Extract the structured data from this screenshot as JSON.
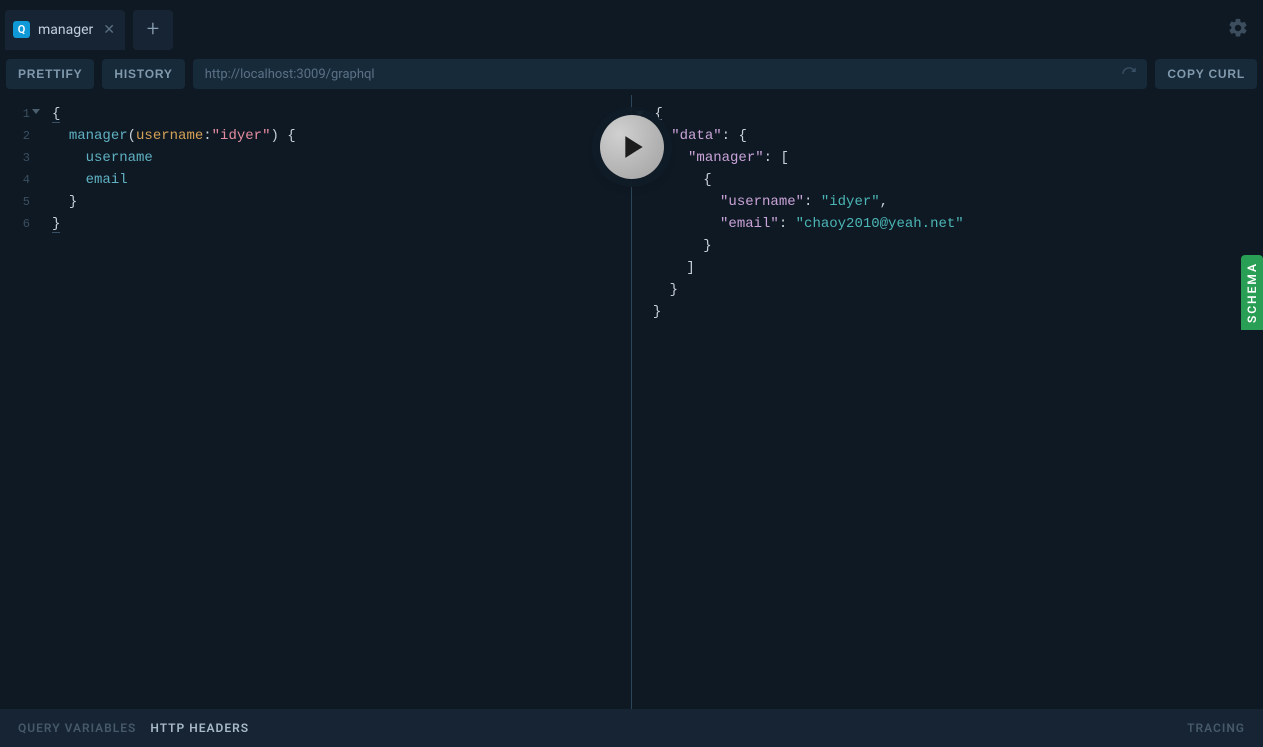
{
  "tabs": {
    "active": {
      "badge": "Q",
      "label": "manager"
    }
  },
  "toolbar": {
    "prettify": "PRETTIFY",
    "history": "HISTORY",
    "url": "http://localhost:3009/graphql",
    "copy_curl": "COPY CURL"
  },
  "editor": {
    "lines": [
      "1",
      "2",
      "3",
      "4",
      "5",
      "6"
    ],
    "tokens": {
      "q_manager": "manager",
      "q_open": "(",
      "q_arg": "username",
      "q_colon": ":",
      "q_argval": "\"idyer\"",
      "q_close": ")",
      "f_username": "username",
      "f_email": "email"
    }
  },
  "result": {
    "data_key": "\"data\"",
    "manager_key": "\"manager\"",
    "username_key": "\"username\"",
    "username_val": "\"idyer\"",
    "email_key": "\"email\"",
    "email_val": "\"chaoy2010@yeah.net\""
  },
  "schema_tab": "SCHEMA",
  "footer": {
    "query_vars": "QUERY VARIABLES",
    "http_headers": "HTTP HEADERS",
    "tracing": "TRACING"
  }
}
